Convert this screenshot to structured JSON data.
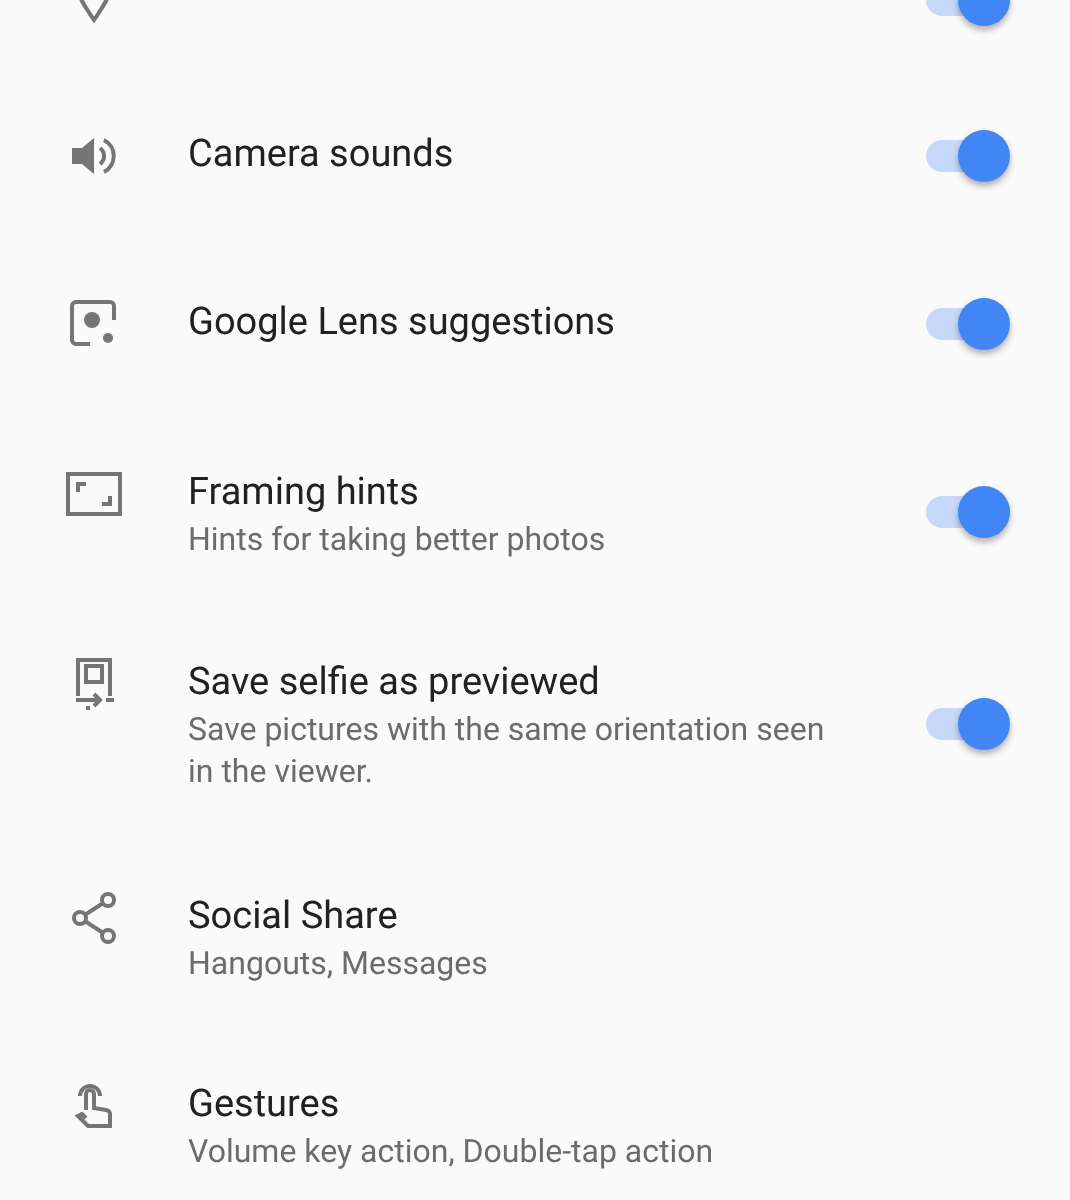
{
  "settings": [
    {
      "toggle": {
        "on": true
      }
    },
    {
      "title": "Camera sounds",
      "toggle": {
        "on": true
      }
    },
    {
      "title": "Google Lens suggestions",
      "toggle": {
        "on": true
      }
    },
    {
      "title": "Framing hints",
      "subtitle": "Hints for taking better photos",
      "toggle": {
        "on": true
      }
    },
    {
      "title": "Save selfie as previewed",
      "subtitle": "Save pictures with the same orientation seen in the viewer.",
      "toggle": {
        "on": true
      }
    },
    {
      "title": "Social Share",
      "subtitle": "Hangouts, Messages"
    },
    {
      "title": "Gestures",
      "subtitle": "Volume key action, Double-tap action"
    }
  ]
}
